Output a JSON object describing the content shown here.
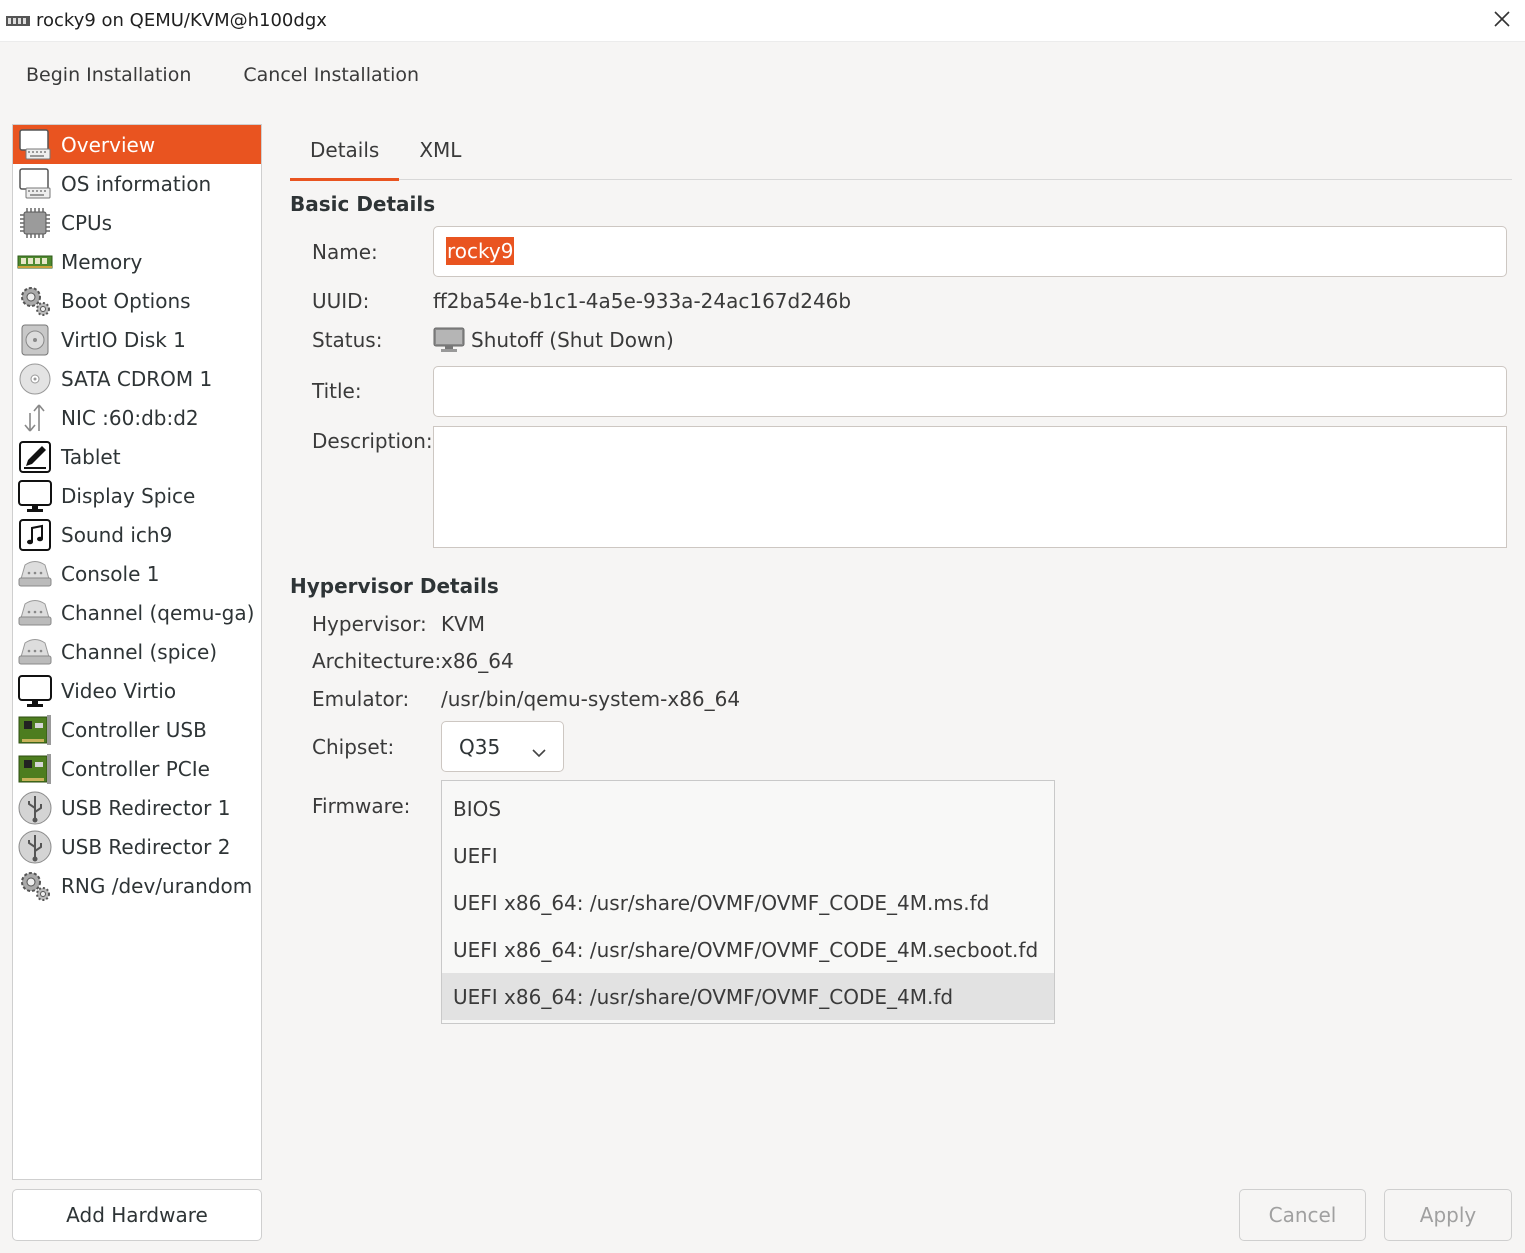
{
  "window": {
    "title": "rocky9 on QEMU/KVM@h100dgx",
    "close_icon": "close-icon",
    "app_icon": "virt-manager-icon"
  },
  "toolbar": {
    "begin_label": "Begin Installation",
    "cancel_label": "Cancel Installation"
  },
  "sidebar": {
    "items": [
      {
        "label": "Overview",
        "icon": "monitor-keyboard-icon",
        "selected": true
      },
      {
        "label": "OS information",
        "icon": "monitor-keyboard-icon"
      },
      {
        "label": "CPUs",
        "icon": "cpu-chip-icon"
      },
      {
        "label": "Memory",
        "icon": "memory-module-icon"
      },
      {
        "label": "Boot Options",
        "icon": "gears-icon"
      },
      {
        "label": "VirtIO Disk 1",
        "icon": "hard-disk-icon"
      },
      {
        "label": "SATA CDROM 1",
        "icon": "cdrom-icon"
      },
      {
        "label": "NIC :60:db:d2",
        "icon": "network-arrows-icon"
      },
      {
        "label": "Tablet",
        "icon": "tablet-pen-icon"
      },
      {
        "label": "Display Spice",
        "icon": "display-monitor-icon"
      },
      {
        "label": "Sound ich9",
        "icon": "music-note-icon"
      },
      {
        "label": "Console 1",
        "icon": "serial-port-icon"
      },
      {
        "label": "Channel (qemu-ga)",
        "icon": "serial-port-icon"
      },
      {
        "label": "Channel (spice)",
        "icon": "serial-port-icon"
      },
      {
        "label": "Video Virtio",
        "icon": "display-monitor-icon"
      },
      {
        "label": "Controller USB",
        "icon": "pci-card-icon"
      },
      {
        "label": "Controller PCIe",
        "icon": "pci-card-icon"
      },
      {
        "label": "USB Redirector 1",
        "icon": "usb-icon"
      },
      {
        "label": "USB Redirector 2",
        "icon": "usb-icon"
      },
      {
        "label": "RNG /dev/urandom",
        "icon": "gears-icon"
      }
    ],
    "add_hardware_label": "Add Hardware"
  },
  "tabs": [
    {
      "label": "Details",
      "active": true
    },
    {
      "label": "XML"
    }
  ],
  "basic": {
    "title": "Basic Details",
    "name_label": "Name:",
    "name_value": "rocky9",
    "uuid_label": "UUID:",
    "uuid_value": "ff2ba54e-b1c1-4a5e-933a-24ac167d246b",
    "status_label": "Status:",
    "status_value": "Shutoff (Shut Down)",
    "status_icon": "shutoff-monitor-icon",
    "title_label": "Title:",
    "title_value": "",
    "description_label": "Description:",
    "description_value": ""
  },
  "hypervisor": {
    "title": "Hypervisor Details",
    "hypervisor_label": "Hypervisor:",
    "hypervisor_value": "KVM",
    "arch_label": "Architecture:",
    "arch_value": "x86_64",
    "emulator_label": "Emulator:",
    "emulator_value": "/usr/bin/qemu-system-x86_64",
    "chipset_label": "Chipset:",
    "chipset_value": "Q35",
    "firmware_label": "Firmware:",
    "firmware_options": [
      "BIOS",
      "UEFI",
      "UEFI x86_64: /usr/share/OVMF/OVMF_CODE_4M.ms.fd",
      "UEFI x86_64: /usr/share/OVMF/OVMF_CODE_4M.secboot.fd",
      "UEFI x86_64: /usr/share/OVMF/OVMF_CODE_4M.fd"
    ],
    "firmware_highlighted": "UEFI x86_64: /usr/share/OVMF/OVMF_CODE_4M.fd"
  },
  "footer": {
    "cancel_label": "Cancel",
    "apply_label": "Apply"
  },
  "colors": {
    "accent": "#e95420",
    "background": "#f6f5f4"
  }
}
